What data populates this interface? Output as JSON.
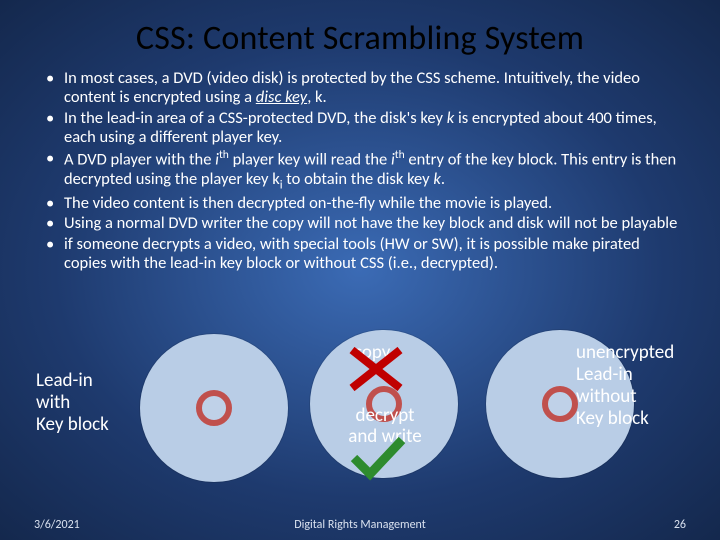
{
  "title": "CSS: Content Scrambling System",
  "bullets": {
    "b1_pre": "In most cases, a DVD (video disk) is protected by the CSS scheme. Intuitively, the video content is encrypted using a ",
    "b1_disc_key": "disc key",
    "b1_post": ", k.",
    "b2_pre": "In the lead-in area of a CSS-protected DVD, the disk's key ",
    "b2_k": "k",
    "b2_post": " is encrypted about 400 times, each using a different player key.",
    "b3_pre": "A DVD player with the ",
    "b3_i1": "i",
    "b3_th": "th",
    "b3_mid1": " player key will read the ",
    "b3_i2": "i",
    "b3_mid2": " entry of the key block. This entry is then decrypted using the player key k",
    "b3_sub_i": "i",
    "b3_mid3": " to obtain the disk key ",
    "b3_k": "k",
    "b3_end": ".",
    "b4": "The video content is then decrypted on-the-fly while the movie is played.",
    "b5": "Using a normal DVD writer  the copy will not have the key block and disk will not be playable",
    "b6": "if someone decrypts a video, with special tools (HW or SW), it is possible make pirated copies with the lead-in key block or without CSS (i.e., decrypted)."
  },
  "diagram": {
    "left_label_l1": "Lead-in",
    "left_label_l2": "with",
    "left_label_l3": "Key block",
    "right_label_l1": "unencrypted",
    "right_label_l2": "Lead-in",
    "right_label_l3": "without",
    "right_label_l4": "Key block",
    "copy": "copy",
    "decrypt_l1": "decrypt",
    "decrypt_l2": "and write"
  },
  "footer": {
    "date": "3/6/2021",
    "center": "Digital Rights Management",
    "page": "26"
  },
  "colors": {
    "cross": "#c00000",
    "check": "#2e8b2e"
  }
}
